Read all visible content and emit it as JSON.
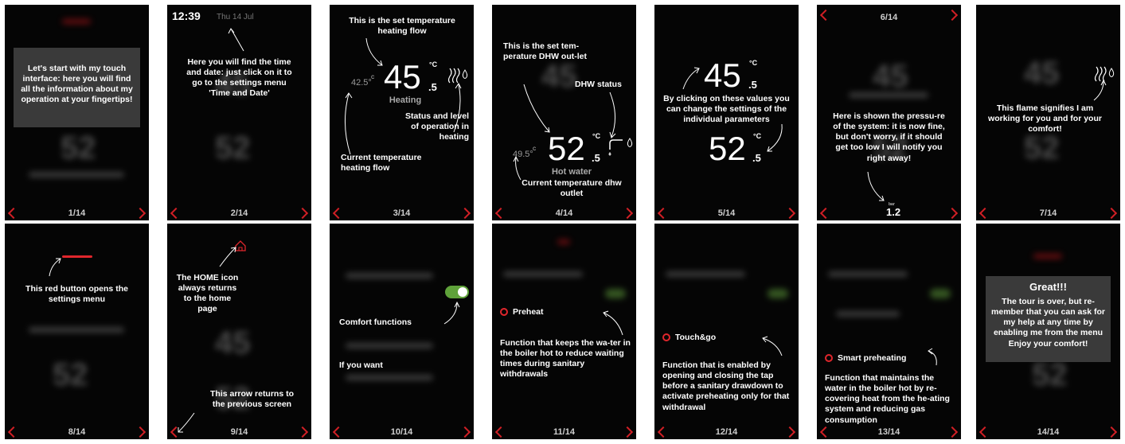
{
  "accent_color": "#d01f25",
  "panels": [
    {
      "page": "1/14",
      "text": "Let's start with my touch interface: here you will find all the information about my operation at your fingertips!"
    },
    {
      "page": "2/14",
      "time": "12:39",
      "date": "Thu 14 Jul",
      "text": "Here you will find the time and date: just click on it to go to the settings menu 'Time and Date'"
    },
    {
      "page": "3/14",
      "title": "This is the set temperature heating flow",
      "value": "45",
      "decimal": ".5",
      "unit": "°C",
      "current": "42.5°",
      "current_unit": "C",
      "label": "Heating",
      "status": "Status and level of operation in heating",
      "current_label": "Current temperature heating flow"
    },
    {
      "page": "4/14",
      "title": "This is the set tem-perature DHW out-let",
      "status": "DHW status",
      "value": "52",
      "decimal": ".5",
      "unit": "°C",
      "current": "49.5°",
      "current_unit": "C",
      "label": "Hot water",
      "current_label": "Current temperature dhw outlet"
    },
    {
      "page": "5/14",
      "value1": "45",
      "decimal1": ".5",
      "unit1": "°C",
      "text": "By clicking on these values you can change the settings of the individual parameters",
      "value2": "52",
      "decimal2": ".5",
      "unit2": "°C"
    },
    {
      "page": "6/14",
      "header": "6/14",
      "text": "Here is shown the pressu-re of the system: it is now fine, but don't worry, if it should get too low I will notify you right away!",
      "pressure": "1.2",
      "pressure_unit": "bar"
    },
    {
      "page": "7/14",
      "text": "This flame signifies I am working for you and for your comfort!"
    },
    {
      "page": "8/14",
      "text": "This red button opens the settings menu"
    },
    {
      "page": "9/14",
      "text_home": "The HOME icon always returns to the home page",
      "text_back": "This arrow returns to the previous screen"
    },
    {
      "page": "10/14",
      "text1": "Comfort functions",
      "text2": "If you want"
    },
    {
      "page": "11/14",
      "option": "Preheat",
      "text": "Function that keeps the wa-ter in the boiler hot to reduce waiting times during sanitary withdrawals"
    },
    {
      "page": "12/14",
      "option": "Touch&go",
      "text": "Function that is enabled by opening and closing the tap before a sanitary drawdown to activate preheating only for that withdrawal"
    },
    {
      "page": "13/14",
      "option": "Smart preheating",
      "text": "Function that maintains the water in the boiler hot by re-covering heat from the he-ating system and reducing gas consumption"
    },
    {
      "page": "14/14",
      "title": "Great!!!",
      "text": "The tour is over, but re-member that you can ask for my help at any time by enabling me from the menu Enjoy your comfort!"
    }
  ]
}
